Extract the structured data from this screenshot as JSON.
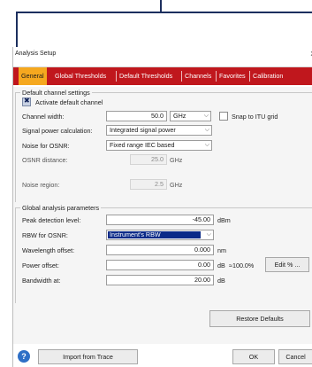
{
  "window": {
    "title": "Analysis Setup",
    "close_glyph": "x"
  },
  "tabs": [
    {
      "label": "General",
      "active": true
    },
    {
      "label": "Global Thresholds"
    },
    {
      "label": "Default Thresholds"
    },
    {
      "label": "Channels"
    },
    {
      "label": "Favorites"
    },
    {
      "label": "Calibration"
    }
  ],
  "default_channel": {
    "group_title": "Default channel settings",
    "activate_label": "Activate default channel",
    "activate_checked": true,
    "channel_width_label": "Channel width:",
    "channel_width_value": "50.0",
    "channel_width_unit": "GHz",
    "snap_label": "Snap to ITU grid",
    "snap_checked": false,
    "signal_power_label": "Signal power calculation:",
    "signal_power_value": "Integrated signal power",
    "noise_osnr_label": "Noise for OSNR:",
    "noise_osnr_value": "Fixed range IEC based",
    "osnr_distance_label": "OSNR distance:",
    "osnr_distance_value": "25.0",
    "osnr_distance_unit": "GHz",
    "noise_region_label": "Noise region:",
    "noise_region_value": "2.5",
    "noise_region_unit": "GHz"
  },
  "global_analysis": {
    "group_title": "Global analysis parameters",
    "peak_label": "Peak detection level:",
    "peak_value": "-45.00",
    "peak_unit": "dBm",
    "rbw_label": "RBW for OSNR:",
    "rbw_value": "Instrument's RBW",
    "wavelength_label": "Wavelength offset:",
    "wavelength_value": "0.000",
    "wavelength_unit": "nm",
    "power_label": "Power offset:",
    "power_value": "0.00",
    "power_unit": "dB",
    "power_percent": "≈100.0%",
    "edit_percent_label": "Edit % ...",
    "bandwidth_label": "Bandwidth at:",
    "bandwidth_value": "20.00",
    "bandwidth_unit": "dB"
  },
  "buttons": {
    "restore_defaults": "Restore Defaults",
    "import_from_trace": "Import from Trace",
    "ok": "OK",
    "cancel": "Cancel",
    "help": "?"
  },
  "colors": {
    "tab_bar": "#c0171d",
    "tab_active": "#f5a81f",
    "selection": "#0a2a88",
    "help_icon": "#2e6fc6"
  }
}
